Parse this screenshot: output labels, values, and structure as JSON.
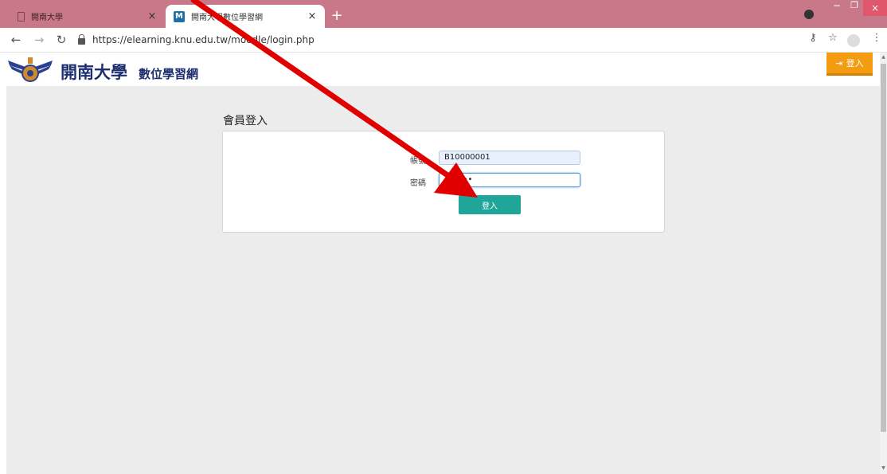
{
  "browser": {
    "tabs": [
      {
        "title": "開南大學",
        "active": false
      },
      {
        "title": "開南大學數位學習網",
        "active": true
      }
    ],
    "tab_close_glyph": "×",
    "new_tab_glyph": "+",
    "url": "https://elearning.knu.edu.tw/moodle/login.php",
    "window_controls": {
      "minimize": "−",
      "maximize": "❐",
      "close": "×"
    },
    "nav_icons": [
      "back-icon",
      "forward-icon",
      "reload-icon"
    ],
    "colors": {
      "tabstrip": "#c9788a",
      "close_button": "#e0566a"
    }
  },
  "site": {
    "brand_main": "開南大學",
    "brand_sub": "數位學習網",
    "header_login_label": "登入",
    "brand_color": "#1c2e6e",
    "login_accent": "#f39c12"
  },
  "login_form": {
    "title": "會員登入",
    "username_label": "帳號",
    "username_value": "B10000001",
    "password_label": "密碼",
    "password_value": "••••••",
    "submit_label": "登入",
    "submit_color": "#1fa59a"
  },
  "annotation": {
    "type": "arrow",
    "color": "#e00000",
    "points_to": "submit-button"
  }
}
